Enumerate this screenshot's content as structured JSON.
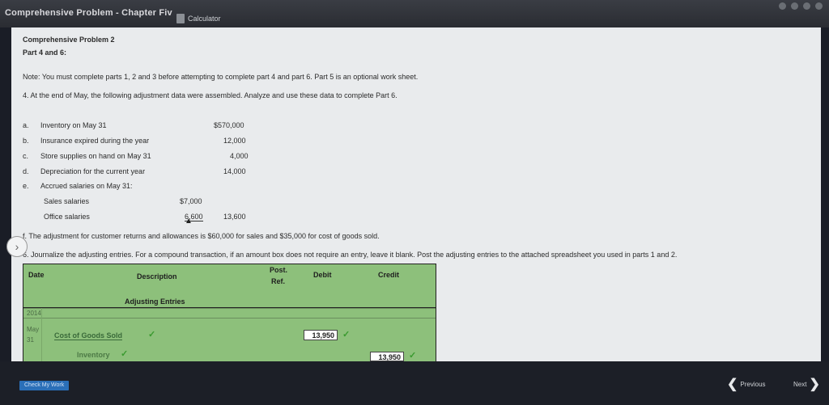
{
  "window": {
    "title": "Comprehensive Problem - Chapter Fiv",
    "calculator_label": "Calculator"
  },
  "header": {
    "problem_title": "Comprehensive Problem 2",
    "part_title": "Part 4 and 6:",
    "note": "Note: You must complete parts 1, 2 and 3 before attempting to complete part 4 and part 6. Part 5 is an optional work sheet.",
    "instruction_4": "4.  At the end of May, the following adjustment data were assembled. Analyze and use these data to complete Part 6."
  },
  "adjustments": [
    {
      "letter": "a.",
      "label": "Inventory on May 31",
      "amount": "$570,000"
    },
    {
      "letter": "b.",
      "label": "Insurance expired during the year",
      "amount": "12,000"
    },
    {
      "letter": "c.",
      "label": "Store supplies on hand on May 31",
      "amount": "4,000"
    },
    {
      "letter": "d.",
      "label": "Depreciation for the current year",
      "amount": "14,000"
    },
    {
      "letter": "e.",
      "label": "Accrued salaries on May 31:",
      "amount": ""
    }
  ],
  "salaries": {
    "sales_label": "Sales salaries",
    "sales_amount": "$7,000",
    "office_label": "Office salaries",
    "office_amount": "6,600",
    "total": "13,600"
  },
  "item_f": "f.  The adjustment for customer returns and allowances is $60,000 for sales and $35,000 for cost of goods sold.",
  "instruction_6": "6.  Journalize the adjusting entries. For a compound transaction, if an amount box does not require an entry, leave it blank. Post the adjusting entries to the attached spreadsheet you used in parts 1 and 2.",
  "table": {
    "headers": {
      "date": "Date",
      "description": "Description",
      "post_ref_1": "Post.",
      "post_ref_2": "Ref.",
      "debit": "Debit",
      "credit": "Credit"
    },
    "section_label": "Adjusting Entries",
    "year": "2014",
    "month": "May",
    "day": "31",
    "rows": [
      {
        "account": "Cost of Goods Sold",
        "debit": "13,950",
        "credit": ""
      },
      {
        "account": "Inventory",
        "debit": "",
        "credit": "13,950"
      }
    ],
    "check_mark": "✓"
  },
  "footer": {
    "check_work": "Check My Work",
    "previous": "Previous",
    "next": "Next"
  }
}
